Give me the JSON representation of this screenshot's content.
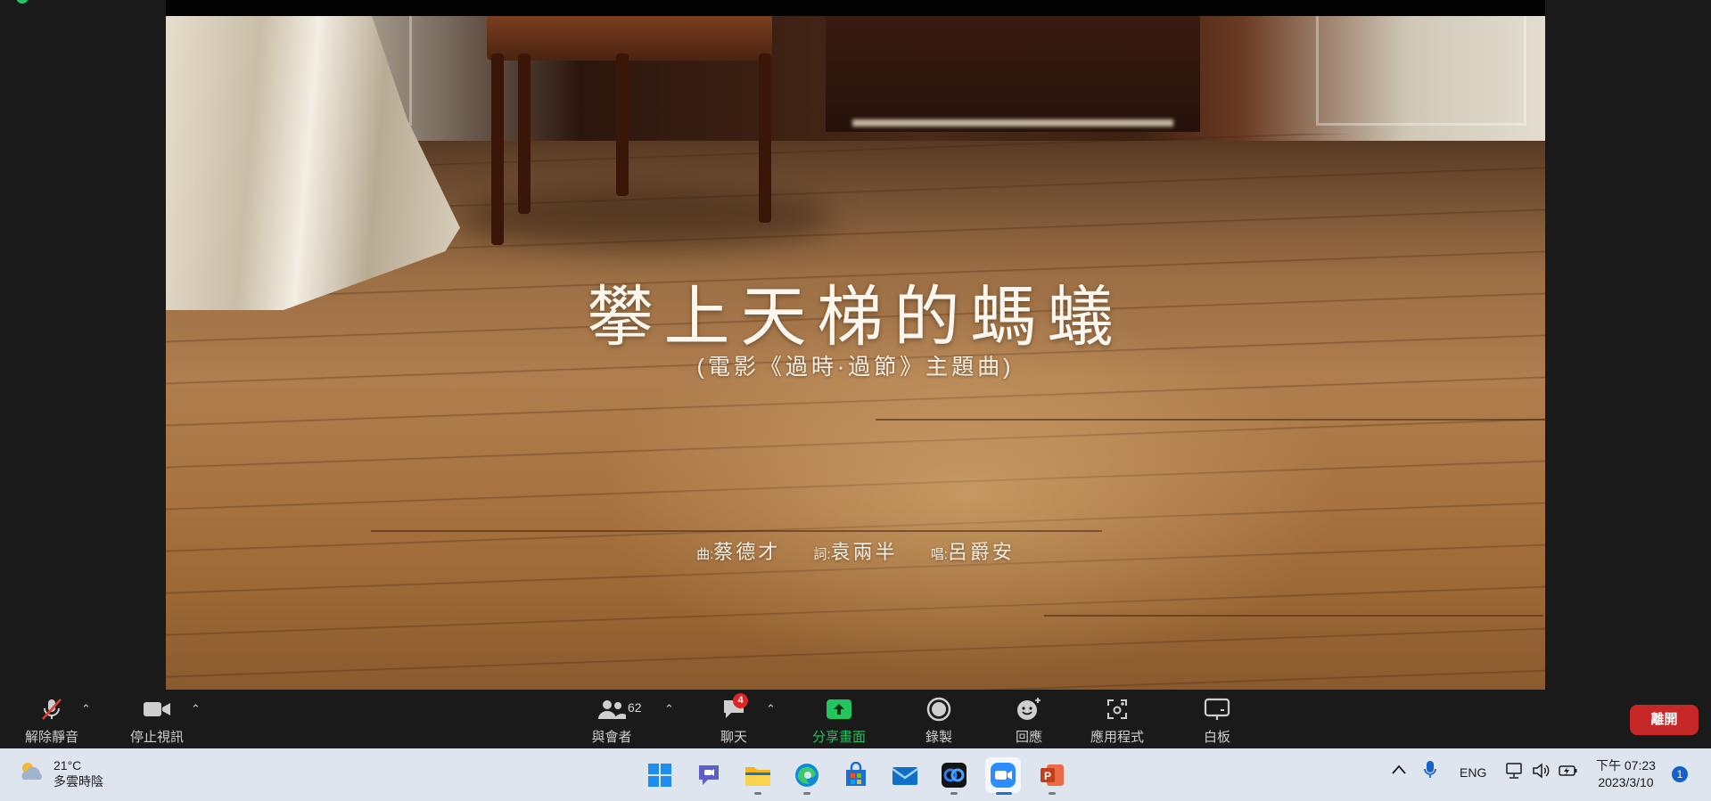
{
  "video": {
    "title": "攀上天梯的螞蟻",
    "subtitle": "(電影《過時·過節》主題曲)",
    "credits": [
      {
        "key": "曲:",
        "value": "蔡德才"
      },
      {
        "key": "詞:",
        "value": "袁兩半"
      },
      {
        "key": "唱:",
        "value": "呂爵安"
      }
    ]
  },
  "toolbar": {
    "unmute_label": "解除靜音",
    "stop_video_label": "停止視訊",
    "participants_label": "與會者",
    "participants_count": "62",
    "chat_label": "聊天",
    "chat_badge": "4",
    "share_label": "分享畫面",
    "record_label": "錄製",
    "reactions_label": "回應",
    "apps_label": "應用程式",
    "whiteboard_label": "白板",
    "leave_label": "離開",
    "share_color": "#22c55e",
    "leave_color": "#c62828"
  },
  "taskbar": {
    "weather_temp": "21°C",
    "weather_desc": "多雲時陰",
    "apps": [
      "windows-start-icon",
      "chat-icon",
      "file-explorer-icon",
      "edge-browser-icon",
      "microsoft-store-icon",
      "mail-icon",
      "app-icon",
      "zoom-icon",
      "powerpoint-icon"
    ],
    "language": "ENG",
    "time": "下午 07:23",
    "date": "2023/3/10",
    "notification_count": "1"
  }
}
